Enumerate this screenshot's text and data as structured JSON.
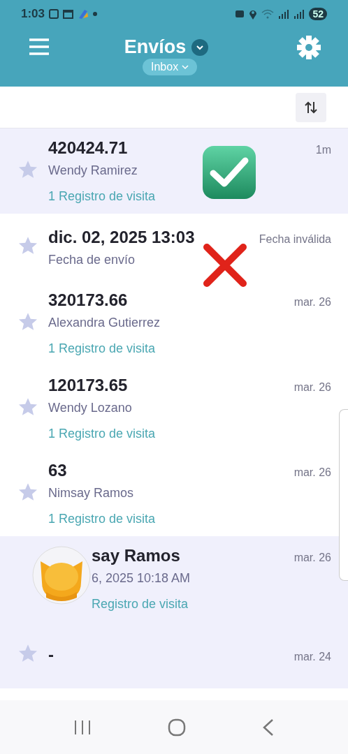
{
  "status_bar": {
    "time": "1:03",
    "battery": "52"
  },
  "header": {
    "title": "Envíos",
    "filter": "Inbox"
  },
  "shipments": [
    {
      "title": "420424.71",
      "subtitle": "Wendy Ramirez",
      "link": "1 Registro de visita",
      "time": "1m",
      "selected": true,
      "sticker": {
        "kind": "check"
      }
    },
    {
      "title": "dic. 02, 2025 13:03",
      "subtitle": "Fecha de envío",
      "time": "Fecha inválida",
      "selected": false,
      "sticker": {
        "kind": "cross"
      }
    },
    {
      "title": "320173.66",
      "subtitle": "Alexandra Gutierrez",
      "link": "1 Registro de visita",
      "time": "mar. 26",
      "selected": false
    },
    {
      "title": "120173.65",
      "subtitle": "Wendy Lozano",
      "link": "1 Registro de visita",
      "time": "mar. 26",
      "selected": false
    },
    {
      "title": "63",
      "subtitle": "Nimsay Ramos",
      "link": "1 Registro de visita",
      "time": "mar. 26",
      "selected": false
    },
    {
      "title": "say Ramos",
      "subtitle": "6, 2025 10:18 AM",
      "link": "Registro de visita",
      "time": "mar. 26",
      "selected": true,
      "bubble": true
    },
    {
      "title": "-",
      "time": "mar. 24",
      "selected": true
    }
  ]
}
